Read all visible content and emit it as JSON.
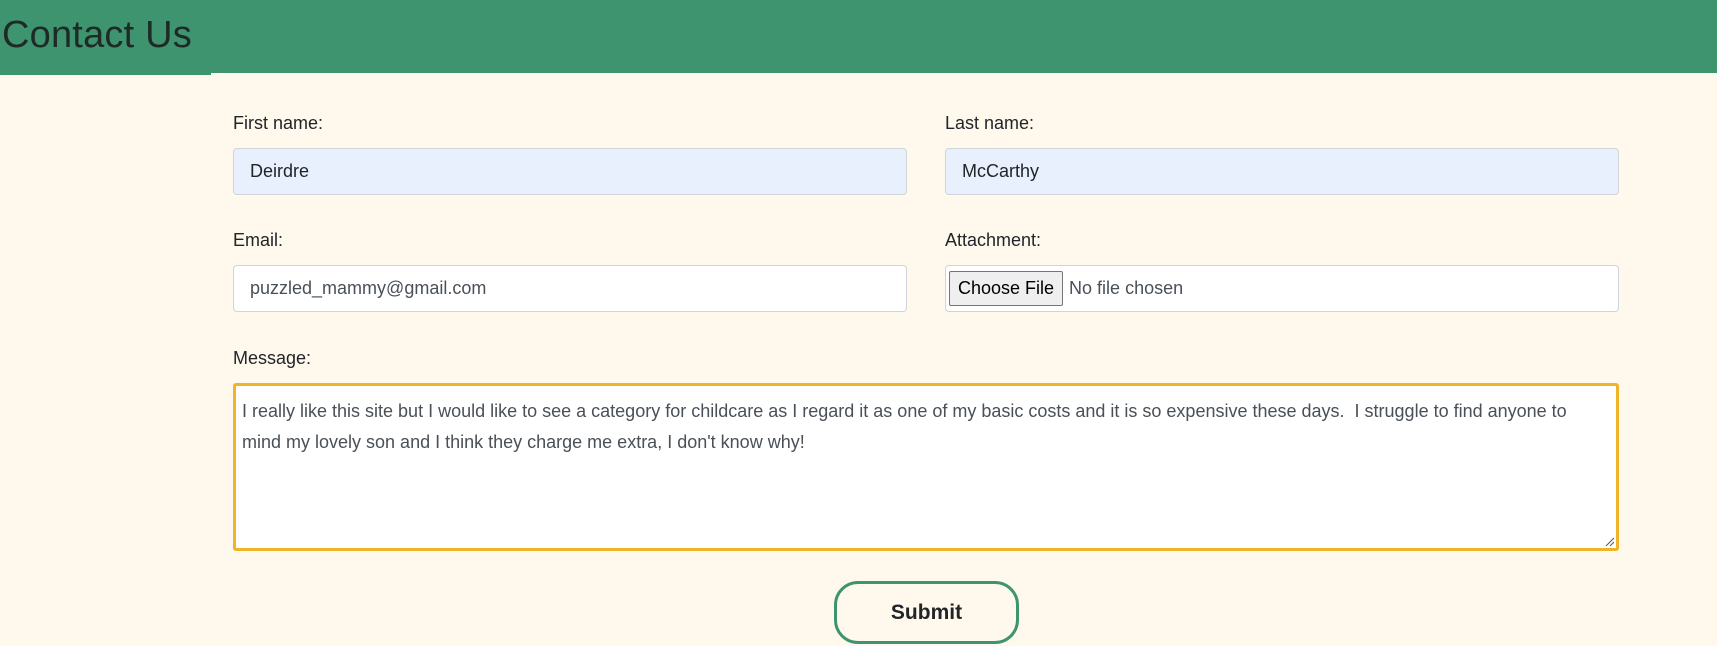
{
  "header": {
    "title": "Contact Us"
  },
  "form": {
    "first_name": {
      "label": "First name:",
      "value": "Deirdre"
    },
    "last_name": {
      "label": "Last name:",
      "value": "McCarthy"
    },
    "email": {
      "label": "Email:",
      "value": "puzzled_mammy@gmail.com"
    },
    "attachment": {
      "label": "Attachment:",
      "button_label": "Choose File",
      "status": "No file chosen"
    },
    "message": {
      "label": "Message:",
      "value": "I really like this site but I would like to see a category for childcare as I regard it as one of my basic costs and it is so expensive these days.  I struggle to find anyone to mind my lovely son and I think they charge me extra, I don't know why!"
    },
    "submit_label": "Submit"
  },
  "colors": {
    "header": "#3f9470",
    "background": "#fff8ec",
    "focus_border": "#f0b429",
    "autofill": "#e8f0fd"
  }
}
